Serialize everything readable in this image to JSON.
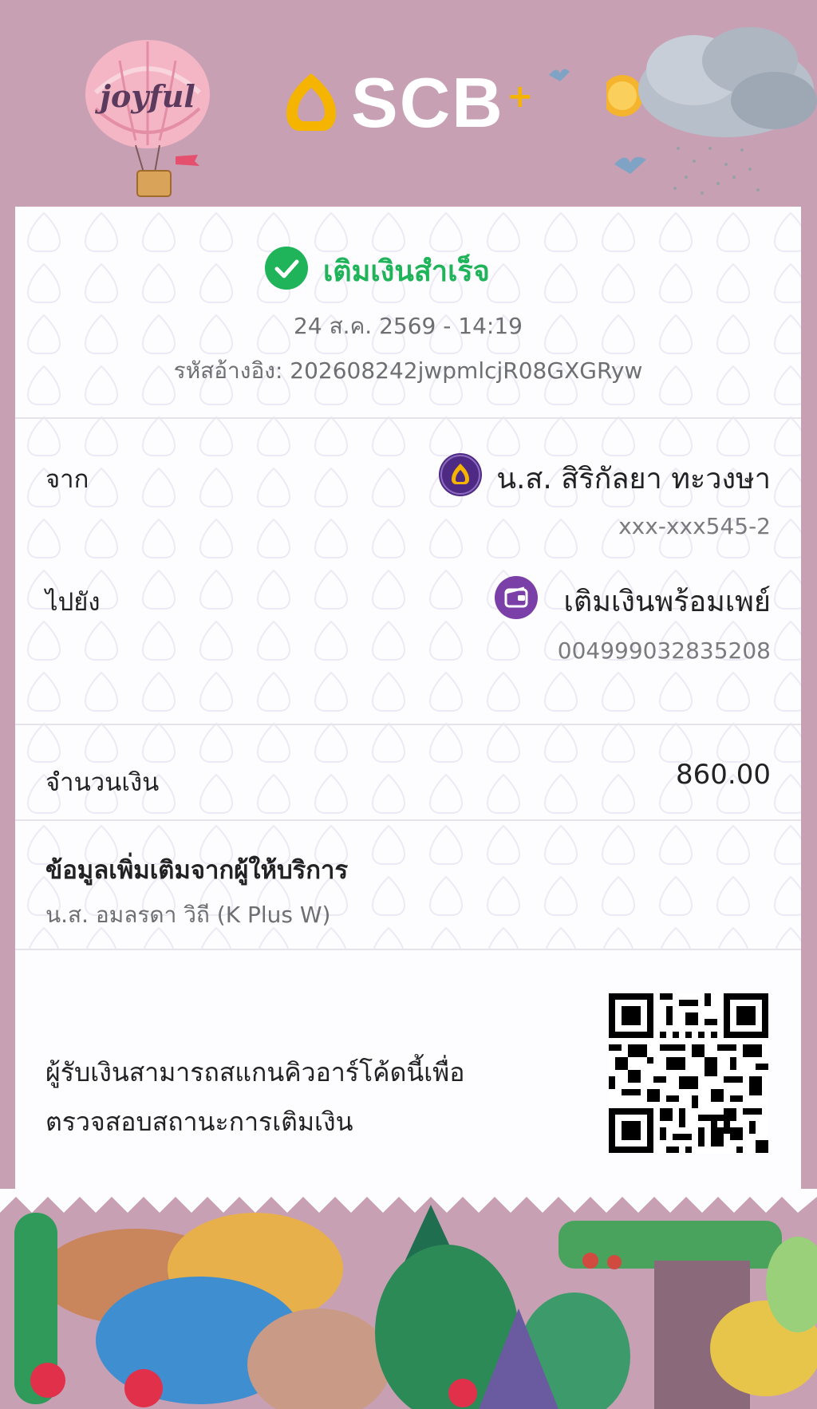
{
  "header": {
    "balloon_text": "joyful",
    "brand": "SCB",
    "brand_suffix": "+"
  },
  "status": {
    "title": "เติมเงินสำเร็จ",
    "datetime": "24 ส.ค. 2569 - 14:19",
    "reference": "รหัสอ้างอิง: 202608242jwpmlcjR08GXGRyw"
  },
  "transfer": {
    "from_label": "จาก",
    "from_name": "น.ส. สิริกัลยา ทะวงษา",
    "from_account": "xxx-xxx545-2",
    "to_label": "ไปยัง",
    "to_name": "เติมเงินพร้อมเพย์",
    "to_account": "004999032835208"
  },
  "amount": {
    "label": "จำนวนเงิน",
    "value": "860.00"
  },
  "provider_info": {
    "title": "ข้อมูลเพิ่มเติมจากผู้ให้บริการ",
    "value": "น.ส. อมลรดา วิถี (K Plus W)"
  },
  "qr": {
    "line1": "ผู้รับเงินสามารถสแกนคิวอาร์โค้ดนี้เพื่อ",
    "line2": "ตรวจสอบสถานะการเติมเงิน"
  },
  "colors": {
    "background": "#c8a0b4",
    "success": "#1fb35a",
    "scb_purple": "#4e2a84",
    "scb_gold": "#f5b400",
    "wallet_purple": "#7b3fa8"
  }
}
